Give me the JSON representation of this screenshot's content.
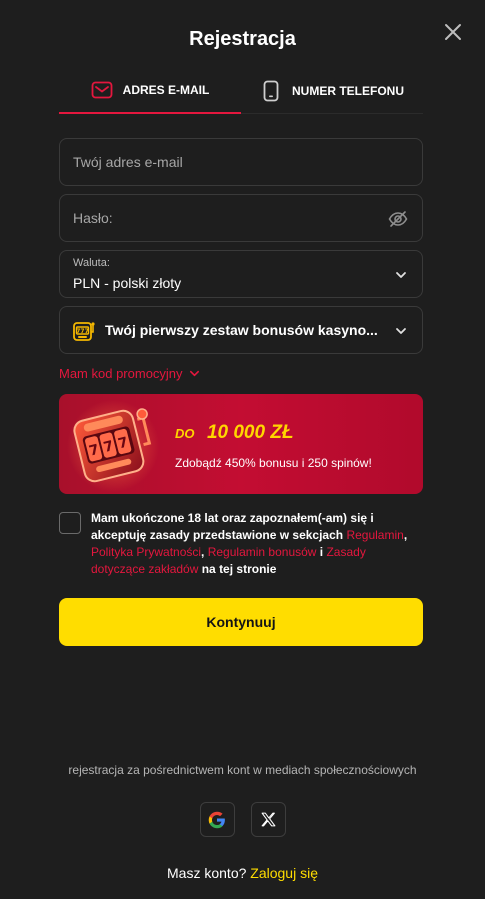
{
  "header": {
    "title": "Rejestracja"
  },
  "tabs": [
    {
      "label": "ADRES E-MAIL",
      "icon": "envelope-icon",
      "active": true
    },
    {
      "label": "NUMER TELEFONU",
      "icon": "phone-icon",
      "active": false
    }
  ],
  "form": {
    "email_placeholder": "Twój adres e-mail",
    "password_placeholder": "Hasło:",
    "currency": {
      "label": "Waluta:",
      "value": "PLN - polski złoty"
    },
    "bonus": {
      "value": "Twój pierwszy zestaw bonusów kasyno..."
    },
    "promo_label": "Mam kod promocyjny"
  },
  "banner": {
    "prefix": "DO",
    "amount": "10 000 ZŁ",
    "subtitle": "Zdobądź 450% bonusu i 250 spinów!"
  },
  "terms": {
    "text1": "Mam ukończone 18 lat oraz zapoznałem(-am) się i akceptuję zasady przedstawione w sekcjach ",
    "link1": "Regulamin",
    "sep1": ", ",
    "link2": "Polityka Prywatności",
    "sep2": ", ",
    "link3": "Regulamin bonusów",
    "sep3": " i ",
    "link4": "Zasady dotyczące zakładów",
    "text2": " na tej stronie"
  },
  "actions": {
    "continue_label": "Kontynuuj"
  },
  "social": {
    "text": "rejestracja za pośrednictwem kont w mediach społecznościowych",
    "buttons": [
      "google-icon",
      "x-icon"
    ]
  },
  "footer": {
    "question": "Masz konto?",
    "login_link": "Zaloguj się"
  },
  "colors": {
    "accent": "#e4173e",
    "cta": "#ffdd00",
    "background": "#1e1e1e"
  }
}
